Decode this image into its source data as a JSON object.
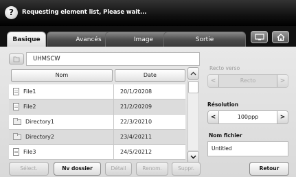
{
  "status": {
    "icon": "question-icon",
    "icon_glyph": "?",
    "message": "Requesting element list, Please wait..."
  },
  "tabs": [
    {
      "label": "Basique",
      "active": true
    },
    {
      "label": "Avancés",
      "active": false
    },
    {
      "label": "Image",
      "active": false
    },
    {
      "label": "Sortie",
      "active": false
    }
  ],
  "header_buttons": {
    "screen_icon": "display-icon",
    "home_icon": "home-icon"
  },
  "path": {
    "folder_icon": "folder-icon",
    "value": "UHMSCW"
  },
  "table": {
    "columns": {
      "name": "Nom",
      "date": "Date"
    },
    "rows": [
      {
        "type": "file",
        "icon": "file-icon",
        "name": "File1",
        "date": "20/1/20208"
      },
      {
        "type": "file",
        "icon": "file-icon",
        "name": "File2",
        "date": "21/2/20209"
      },
      {
        "type": "directory",
        "icon": "folder-icon",
        "name": "Directory1",
        "date": "22/3/20210"
      },
      {
        "type": "directory",
        "icon": "folder-icon",
        "name": "Directory2",
        "date": "23/4/20211"
      },
      {
        "type": "file",
        "icon": "file-icon",
        "name": "File3",
        "date": "24/5/20212"
      }
    ]
  },
  "scroll": {
    "up_glyph": "︿",
    "down_glyph": "﹀"
  },
  "options": {
    "duplex": {
      "label": "Recto verso",
      "value": "Recto",
      "enabled": false
    },
    "resolution": {
      "label": "Résolution",
      "value": "100ppp",
      "enabled": true
    },
    "filename": {
      "label": "Nom fichier",
      "value": "Untitled"
    },
    "arrow_left": "<",
    "arrow_right": ">"
  },
  "buttons": {
    "select": {
      "label": "Sélect.",
      "enabled": false
    },
    "new_folder": {
      "label": "Nv dossier",
      "enabled": true
    },
    "detail": {
      "label": "Détail",
      "enabled": false
    },
    "rename": {
      "label": "Renom.",
      "enabled": false
    },
    "delete": {
      "label": "Suppr.",
      "enabled": false
    },
    "back": {
      "label": "Retour",
      "enabled": true
    }
  }
}
